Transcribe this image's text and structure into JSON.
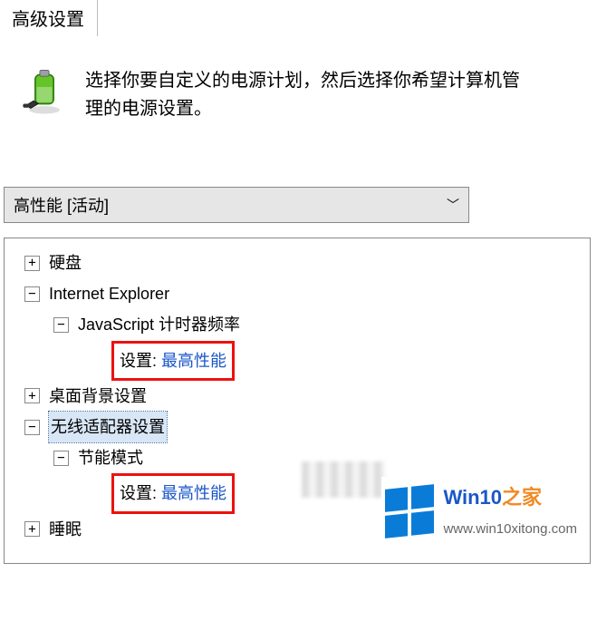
{
  "tab_label": "高级设置",
  "description": "选择你要自定义的电源计划，然后选择你希望计算机管理的电源设置。",
  "plan_selected": "高性能 [活动]",
  "tree": {
    "hard_disk": "硬盘",
    "ie": "Internet Explorer",
    "js_timer": "JavaScript 计时器频率",
    "setting_label": "设置:",
    "setting_value": "最高性能",
    "desktop_bg": "桌面背景设置",
    "wireless": "无线适配器设置",
    "power_saving": "节能模式",
    "sleep": "睡眠"
  },
  "watermark": {
    "brand_main": "Win10",
    "brand_suffix": "之家",
    "url": "www.win10xitong.com"
  }
}
